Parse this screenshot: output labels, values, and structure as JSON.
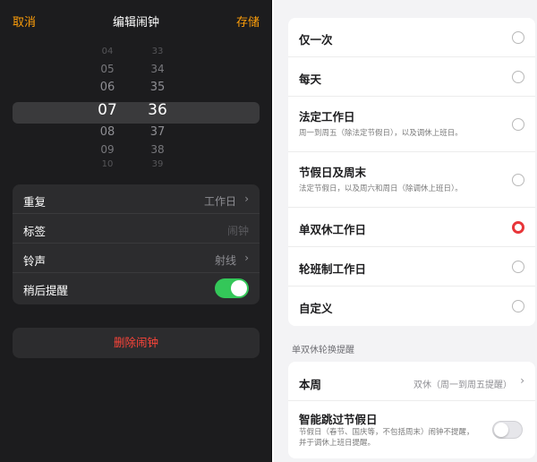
{
  "left": {
    "topbar": {
      "cancel": "取消",
      "title": "编辑闹钟",
      "save": "存储"
    },
    "picker": {
      "hours": [
        "04",
        "05",
        "06",
        "07",
        "08",
        "09",
        "10"
      ],
      "minutes": [
        "33",
        "34",
        "35",
        "36",
        "37",
        "38",
        "39"
      ],
      "selected_index": 3
    },
    "settings": {
      "repeat_label": "重复",
      "repeat_value": "工作日",
      "label_label": "标签",
      "label_value": "闹钟",
      "sound_label": "铃声",
      "sound_value": "射线",
      "snooze_label": "稍后提醒"
    },
    "delete_label": "删除闹钟",
    "colors": {
      "accent": "#ff9f0a",
      "danger": "#ff453a",
      "switch_on": "#34c759"
    }
  },
  "right": {
    "options": [
      {
        "title": "仅一次",
        "sub": ""
      },
      {
        "title": "每天",
        "sub": ""
      },
      {
        "title": "法定工作日",
        "sub": "周一到周五（除法定节假日），以及调休上班日。"
      },
      {
        "title": "节假日及周末",
        "sub": "法定节假日，以及周六和周日（除调休上班日）。"
      },
      {
        "title": "单双休工作日",
        "sub": ""
      },
      {
        "title": "轮班制工作日",
        "sub": ""
      },
      {
        "title": "自定义",
        "sub": ""
      }
    ],
    "selected_option": 4,
    "section_header": "单双休轮换提醒",
    "this_week_label": "本周",
    "this_week_value": "双休（周一到周五提醒）",
    "skip_holiday_label": "智能跳过节假日",
    "skip_holiday_desc": "节假日（春节、国庆等，不包括周末）闹钟不提醒，并于调休上班日提醒。",
    "colors": {
      "radio_selected": "#e8363a"
    }
  }
}
